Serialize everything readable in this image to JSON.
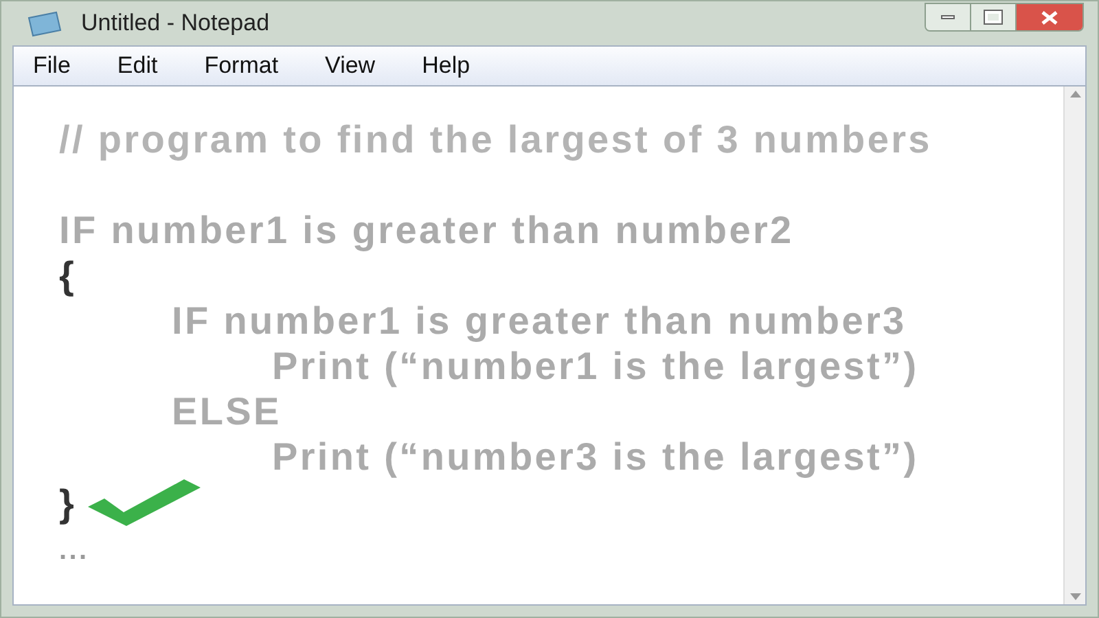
{
  "window": {
    "title": "Untitled - Notepad"
  },
  "menu": [
    "File",
    "Edit",
    "Format",
    "View",
    "Help"
  ],
  "lines": [
    {
      "kind": "comment",
      "text": "// program to find the largest of 3 numbers"
    },
    {
      "kind": "code",
      "text": "IF number1 is greater than number2"
    },
    {
      "kind": "brace",
      "text": "{",
      "children": [
        {
          "kind": "code",
          "text": "IF number1 is greater than number3",
          "children": [
            {
              "kind": "code",
              "text": "Print (“number1 is the largest”)"
            }
          ]
        },
        {
          "kind": "code",
          "text": "ELSE",
          "children": [
            {
              "kind": "code",
              "text": "Print (“number3 is the largest”)"
            }
          ]
        }
      ]
    },
    {
      "kind": "closing_brace",
      "text": "}"
    },
    {
      "kind": "ellipsis",
      "text": "..."
    }
  ]
}
